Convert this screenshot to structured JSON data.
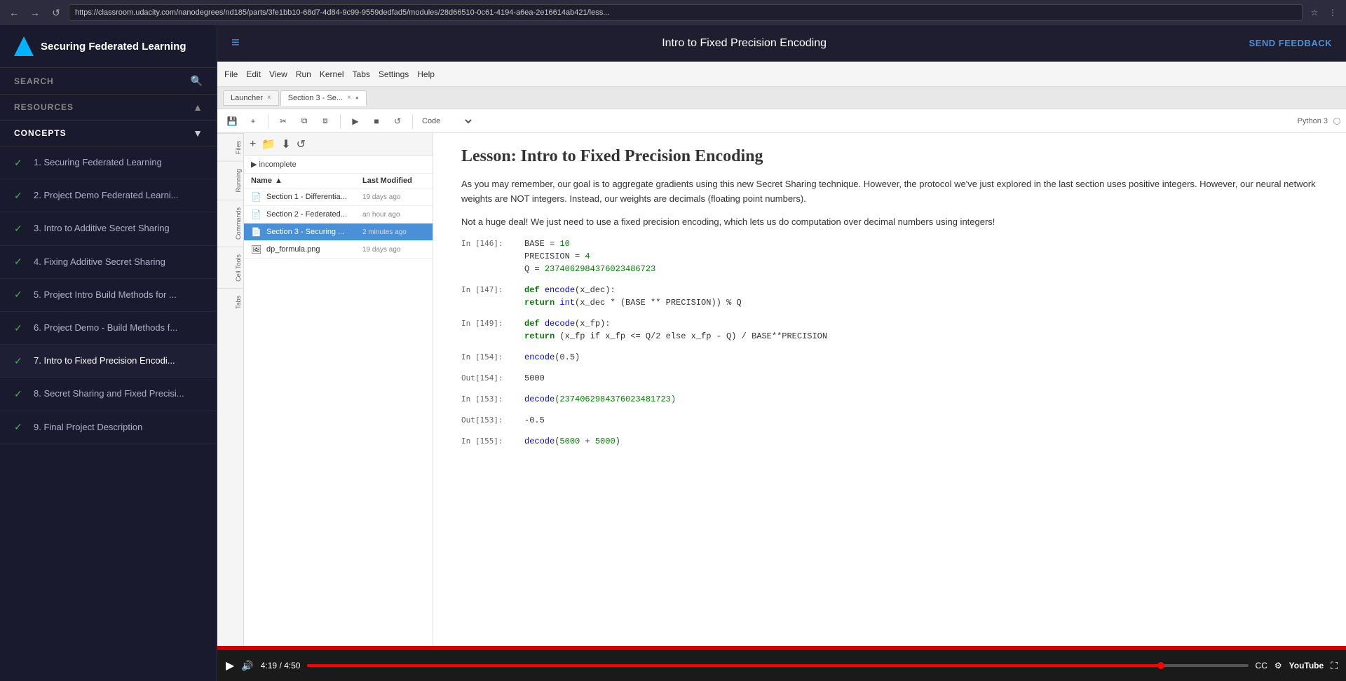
{
  "browser": {
    "url": "https://classroom.udacity.com/nanodegrees/nd185/parts/3fe1bb10-68d7-4d84-9c99-9559dedfad5/modules/28d66510-0c61-4194-a6ea-2e16614ab421/less...",
    "nav_back": "←",
    "nav_fwd": "→",
    "nav_refresh": "↺",
    "nav_home": "⌂"
  },
  "sidebar": {
    "logo_alt": "Udacity logo",
    "title": "Securing Federated Learning",
    "search_label": "SEARCH",
    "resources_label": "RESOURCES",
    "concepts_label": "CONCEPTS",
    "resources_arrow": "▲",
    "concepts_arrow": "▼",
    "nav_items": [
      {
        "id": 1,
        "label": "1. Securing Federated Learning",
        "done": true,
        "current": false
      },
      {
        "id": 2,
        "label": "2. Project Demo Federated Learni...",
        "done": true,
        "current": false
      },
      {
        "id": 3,
        "label": "3. Intro to Additive Secret Sharing",
        "done": true,
        "current": false
      },
      {
        "id": 4,
        "label": "4. Fixing Additive Secret Sharing",
        "done": true,
        "current": false
      },
      {
        "id": 5,
        "label": "5. Project Intro Build Methods for ...",
        "done": true,
        "current": false
      },
      {
        "id": 6,
        "label": "6. Project Demo - Build Methods f...",
        "done": true,
        "current": false
      },
      {
        "id": 7,
        "label": "7. Intro to Fixed Precision Encodi...",
        "done": true,
        "current": true
      },
      {
        "id": 8,
        "label": "8. Secret Sharing and Fixed Precisi...",
        "done": true,
        "current": false
      },
      {
        "id": 9,
        "label": "9. Final Project Description",
        "done": true,
        "current": false
      }
    ]
  },
  "topbar": {
    "menu_icon": "≡",
    "title": "Intro to Fixed Precision Encoding",
    "feedback_label": "SEND FEEDBACK"
  },
  "jupyter": {
    "menu_items": [
      "File",
      "Edit",
      "View",
      "Run",
      "Kernel",
      "Tabs",
      "Settings",
      "Help"
    ],
    "tabs": [
      {
        "label": "Launcher",
        "active": false,
        "closeable": true
      },
      {
        "label": "Section 3 - Se...",
        "active": true,
        "closeable": true,
        "modified": true
      }
    ],
    "toolbar": {
      "save": "💾",
      "add": "+",
      "cut": "✂",
      "copy": "⧉",
      "paste": "⧈",
      "run": "▶",
      "interrupt": "■",
      "refresh": "↺",
      "cell_type": "Code",
      "kernel_name": "Python 3"
    },
    "sidebar_labels": [
      "Files",
      "Running",
      "Commands",
      "Cell Tools",
      "Tabs"
    ],
    "file_panel": {
      "breadcrumb": "▶ incomplete",
      "col_name": "Name",
      "col_modified": "Last Modified",
      "files": [
        {
          "name": "Section 1 - Differentia...",
          "modified": "19 days ago",
          "icon": "📄",
          "selected": false
        },
        {
          "name": "Section 2 - Federated...",
          "modified": "an hour ago",
          "icon": "📄",
          "selected": false
        },
        {
          "name": "Section 3 - Securing ...",
          "modified": "2 minutes ago",
          "icon": "📄",
          "selected": true
        },
        {
          "name": "dp_formula.png",
          "modified": "19 days ago",
          "icon": "🖼",
          "selected": false
        }
      ]
    },
    "notebook": {
      "title": "Lesson: Intro to Fixed Precision Encoding",
      "para1": "As you may remember, our goal is to aggregate gradients using this new Secret Sharing technique. However, the protocol we've just explored in the last section uses positive integers. However, our neural network weights are NOT integers. Instead, our weights are decimals (floating point numbers).",
      "para2": "Not a huge deal! We just need to use a fixed precision encoding, which lets us do computation over decimal numbers using integers!",
      "cells": [
        {
          "prompt_in": "In [146]:",
          "prompt_out": "",
          "type": "code",
          "lines": [
            {
              "text": "BASE = 10",
              "parts": [
                {
                  "t": "BASE",
                  "c": "var"
                },
                {
                  "t": " = ",
                  "c": "op"
                },
                {
                  "t": "10",
                  "c": "num"
                }
              ]
            },
            {
              "text": "PRECISION = 4",
              "parts": [
                {
                  "t": "PRECISION",
                  "c": "var"
                },
                {
                  "t": " = ",
                  "c": "op"
                },
                {
                  "t": "4",
                  "c": "num"
                }
              ]
            },
            {
              "text": "Q = 2374062984376023486723",
              "parts": [
                {
                  "t": "Q",
                  "c": "var"
                },
                {
                  "t": " = ",
                  "c": "op"
                },
                {
                  "t": "2374062984376023486723",
                  "c": "num"
                }
              ]
            }
          ]
        },
        {
          "prompt_in": "In [147]:",
          "prompt_out": "",
          "type": "code",
          "lines": [
            {
              "text": "def encode(x_dec):",
              "parts": [
                {
                  "t": "def ",
                  "c": "kw"
                },
                {
                  "t": "encode",
                  "c": "fn"
                },
                {
                  "t": "(x_dec):",
                  "c": "var"
                }
              ]
            },
            {
              "text": "    return int(x_dec * (BASE ** PRECISION)) % Q",
              "parts": [
                {
                  "t": "    ",
                  "c": "var"
                },
                {
                  "t": "return ",
                  "c": "kw"
                },
                {
                  "t": "int",
                  "c": "fn"
                },
                {
                  "t": "(x_dec * (BASE ** PRECISION)) % Q",
                  "c": "var"
                }
              ]
            }
          ]
        },
        {
          "prompt_in": "In [149]:",
          "prompt_out": "",
          "type": "code",
          "lines": [
            {
              "text": "def decode(x_fp):",
              "parts": [
                {
                  "t": "def ",
                  "c": "kw"
                },
                {
                  "t": "decode",
                  "c": "fn"
                },
                {
                  "t": "(x_fp):",
                  "c": "var"
                }
              ]
            },
            {
              "text": "    return (x_fp if x_fp <= Q/2 else x_fp - Q) / BASE**PRECISION",
              "parts": [
                {
                  "t": "    ",
                  "c": "var"
                },
                {
                  "t": "return ",
                  "c": "kw"
                },
                {
                  "t": "(x_fp if x_fp <= Q/2 else x_fp - Q) / BASE**PRECISION",
                  "c": "var"
                }
              ]
            }
          ]
        },
        {
          "prompt_in": "In [154]:",
          "prompt_out": "Out[154]:",
          "type": "code",
          "lines": [
            {
              "text": "encode(0.5)",
              "parts": [
                {
                  "t": "encode",
                  "c": "fn"
                },
                {
                  "t": "(0.5)",
                  "c": "var"
                }
              ]
            }
          ],
          "output": "5000"
        },
        {
          "prompt_in": "In [153]:",
          "prompt_out": "Out[153]:",
          "type": "code",
          "lines": [
            {
              "text": "decode(2374062984376023481723)",
              "parts": [
                {
                  "t": "decode",
                  "c": "fn"
                },
                {
                  "t": "(2374062984376023481723)",
                  "c": "num"
                }
              ]
            }
          ],
          "output": "-0.5"
        },
        {
          "prompt_in": "In [155]:",
          "prompt_out": "",
          "type": "code",
          "lines": [
            {
              "text": "decode(5000 + 5000)",
              "parts": [
                {
                  "t": "decode",
                  "c": "fn"
                },
                {
                  "t": "(",
                  "c": "op"
                },
                {
                  "t": "5000",
                  "c": "num"
                },
                {
                  "t": " + ",
                  "c": "op"
                },
                {
                  "t": "5000",
                  "c": "num"
                },
                {
                  "t": ")",
                  "c": "op"
                }
              ]
            }
          ]
        }
      ]
    }
  },
  "video_controls": {
    "play_icon": "▶",
    "volume_icon": "🔊",
    "time_current": "4:19",
    "time_separator": " / ",
    "time_total": "4:50",
    "progress_pct": 90.7,
    "cc_label": "CC",
    "settings_icon": "⚙",
    "youtube_label": "YouTube",
    "fullscreen_icon": "⛶"
  }
}
